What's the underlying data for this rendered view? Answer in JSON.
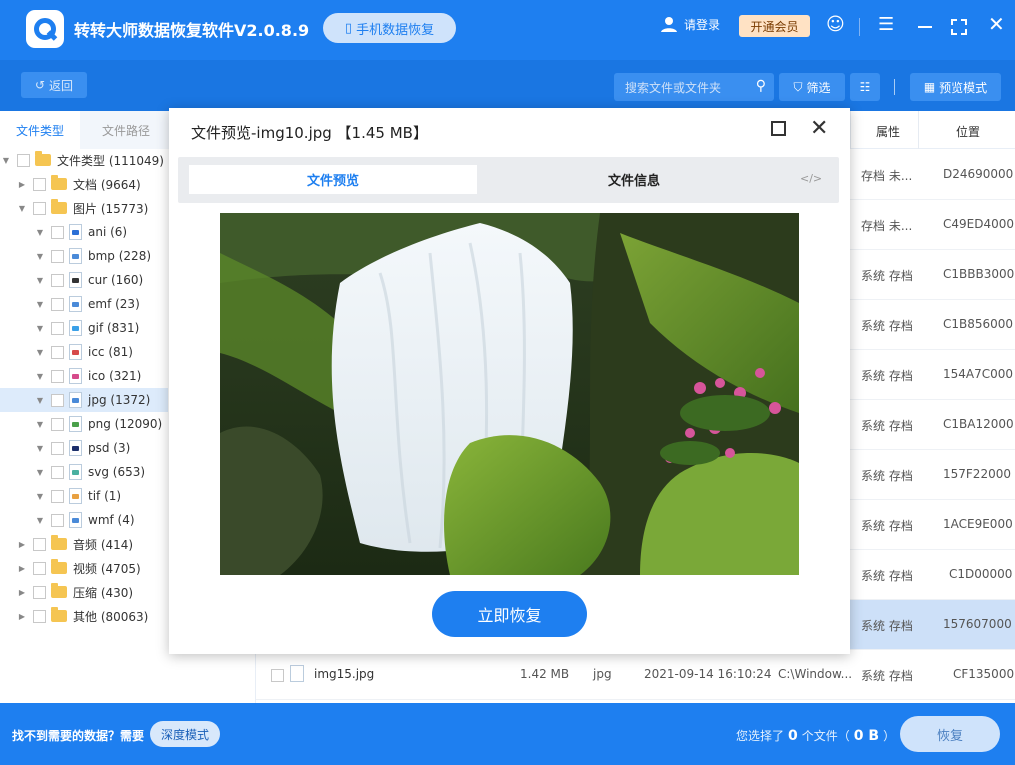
{
  "app": {
    "title": "转转大师数据恢复软件V2.0.8.9",
    "mobile_recovery": "手机数据恢复",
    "login": "请登录",
    "vip": "开通会员"
  },
  "toolbar": {
    "back": "返回",
    "search_placeholder": "搜索文件或文件夹",
    "filter": "筛选",
    "preview_mode": "预览模式"
  },
  "left_tabs": {
    "by_type": "文件类型",
    "by_path": "文件路径"
  },
  "tree": [
    {
      "label": "文件类型 (111049)",
      "level": 0,
      "arrow": "down",
      "kind": "folder"
    },
    {
      "label": "文档 (9664)",
      "level": 1,
      "arrow": "right",
      "kind": "folder"
    },
    {
      "label": "图片 (15773)",
      "level": 1,
      "arrow": "down",
      "kind": "folder"
    },
    {
      "label": "ani (6)",
      "level": 2,
      "arrow": "down",
      "kind": "file",
      "color": "#2b6fd6"
    },
    {
      "label": "bmp (228)",
      "level": 2,
      "arrow": "down",
      "kind": "file",
      "color": "#4a8ad8"
    },
    {
      "label": "cur (160)",
      "level": 2,
      "arrow": "down",
      "kind": "file",
      "color": "#333333"
    },
    {
      "label": "emf (23)",
      "level": 2,
      "arrow": "down",
      "kind": "file",
      "color": "#4a8ad8"
    },
    {
      "label": "gif (831)",
      "level": 2,
      "arrow": "down",
      "kind": "file",
      "color": "#3aa0e8"
    },
    {
      "label": "icc (81)",
      "level": 2,
      "arrow": "down",
      "kind": "file",
      "color": "#d64a4a"
    },
    {
      "label": "ico (321)",
      "level": 2,
      "arrow": "down",
      "kind": "file",
      "color": "#d64a8a"
    },
    {
      "label": "jpg (1372)",
      "level": 2,
      "arrow": "down",
      "kind": "file",
      "color": "#4a8ad8",
      "selected": true
    },
    {
      "label": "png (12090)",
      "level": 2,
      "arrow": "down",
      "kind": "file",
      "color": "#4aa04a"
    },
    {
      "label": "psd (3)",
      "level": 2,
      "arrow": "down",
      "kind": "file",
      "color": "#1c2f6b"
    },
    {
      "label": "svg (653)",
      "level": 2,
      "arrow": "down",
      "kind": "file",
      "color": "#4ab0a0"
    },
    {
      "label": "tif (1)",
      "level": 2,
      "arrow": "down",
      "kind": "file",
      "color": "#e8a040"
    },
    {
      "label": "wmf (4)",
      "level": 2,
      "arrow": "down",
      "kind": "file",
      "color": "#4a8ad8"
    },
    {
      "label": "音频 (414)",
      "level": 1,
      "arrow": "right",
      "kind": "folder"
    },
    {
      "label": "视频 (4705)",
      "level": 1,
      "arrow": "right",
      "kind": "folder"
    },
    {
      "label": "压缩 (430)",
      "level": 1,
      "arrow": "right",
      "kind": "folder"
    },
    {
      "label": "其他 (80063)",
      "level": 1,
      "arrow": "right",
      "kind": "folder"
    }
  ],
  "table": {
    "headers": {
      "attr": "属性",
      "location": "位置"
    },
    "rows": [
      {
        "attr": "存档 未...",
        "loc": "D24690000"
      },
      {
        "attr": "存档 未...",
        "loc": "C49ED4000"
      },
      {
        "attr": "系统 存档",
        "loc": "C1BBB3000"
      },
      {
        "attr": "系统 存档",
        "loc": "C1B856000"
      },
      {
        "attr": "系统 存档",
        "loc": "154A7C000"
      },
      {
        "attr": "系统 存档",
        "loc": "C1BA12000"
      },
      {
        "attr": "系统 存档",
        "loc": "157F22000"
      },
      {
        "attr": "系统 存档",
        "loc": "1ACE9E000"
      },
      {
        "attr": "系统 存档",
        "loc": "C1D00000"
      },
      {
        "attr": "系统 存档",
        "loc": "157607000",
        "selected": true
      }
    ],
    "last_row": {
      "name": "img15.jpg",
      "size": "1.42 MB",
      "type": "jpg",
      "date": "2021-09-14 16:10:24",
      "path": "C:\\Window...",
      "attr": "系统 存档",
      "loc": "CF135000"
    }
  },
  "modal": {
    "title": "文件预览-img10.jpg 【1.45 MB】",
    "tab_preview": "文件预览",
    "tab_info": "文件信息",
    "code_icon": "</>",
    "restore": "立即恢复"
  },
  "footer": {
    "not_found": "找不到需要的数据？需要",
    "deep_mode": "深度模式",
    "selected_prefix": "您选择了",
    "selected_count": "0",
    "selected_mid": "个文件（",
    "selected_size": "0 B",
    "selected_suffix": "）",
    "recover": "恢复"
  },
  "colors": {
    "primary": "#1e7ff0",
    "toolbar": "#1a76e2",
    "selected_row": "#cde0f8"
  }
}
